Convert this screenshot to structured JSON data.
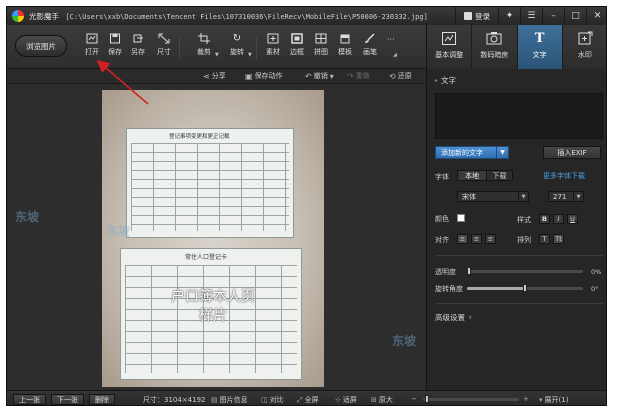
{
  "window": {
    "app_title": "光影魔手",
    "file_path": "[C:\\Users\\xxb\\Documents\\Tencent Files\\107310036\\FileRecv\\MobileFile\\P50606-230332.jpg]",
    "login_label": "登录"
  },
  "toolbar": {
    "browse_label": "浏览图片",
    "tools": [
      {
        "label": "打开",
        "icon": "open-icon"
      },
      {
        "label": "保存",
        "icon": "save-icon"
      },
      {
        "label": "另存",
        "icon": "save-as-icon"
      },
      {
        "label": "尺寸",
        "icon": "resize-icon"
      },
      {
        "label": "裁剪",
        "icon": "crop-icon"
      },
      {
        "label": "旋转",
        "icon": "rotate-icon"
      },
      {
        "label": "素材",
        "icon": "material-icon"
      },
      {
        "label": "边框",
        "icon": "border-icon"
      },
      {
        "label": "拼图",
        "icon": "collage-icon"
      },
      {
        "label": "模板",
        "icon": "template-icon"
      },
      {
        "label": "画笔",
        "icon": "brush-icon"
      }
    ],
    "more_label": "···"
  },
  "mode_tabs": [
    {
      "label": "基本调整",
      "icon": "adjust-icon",
      "active": false
    },
    {
      "label": "数码暗房",
      "icon": "camera-icon",
      "active": false
    },
    {
      "label": "文字",
      "icon": "text-T-icon",
      "active": true
    },
    {
      "label": "水印",
      "icon": "watermark-icon",
      "active": false
    }
  ],
  "actions": {
    "share": "分享",
    "save_action": "保存动作",
    "undo": "撤销",
    "redo": "重做",
    "restore": "还原"
  },
  "photo": {
    "card_top_title": "登记事项变更和更正记载",
    "card_bottom_title": "常住人口登记卡",
    "overlay_line1": "户口簿本人页",
    "overlay_line2": "样片",
    "watermark": "东坡"
  },
  "panel": {
    "section_text": "文字",
    "add_text_button": "添加新的文字",
    "insert_exif_button": "插入EXIF",
    "font_label": "字体",
    "font_local": "本地",
    "font_download": "下载",
    "more_fonts_link": "更多字体下载",
    "font_family": "宋体",
    "font_size": "271",
    "color_label": "颜色",
    "style_label": "样式",
    "style_bold": "B",
    "style_italic": "I",
    "style_underline": "U",
    "align_label": "对齐",
    "arrange_label": "排列",
    "opacity_label": "透明度",
    "opacity_value": "0%",
    "opacity_fraction": 0.0,
    "rotation_label": "旋转角度",
    "rotation_value": "0°",
    "rotation_fraction": 0.5,
    "advanced_label": "高级设置",
    "text_color": "#ffffff"
  },
  "status": {
    "prev": "上一张",
    "next": "下一张",
    "delete": "删除",
    "size": "尺寸：3104×4192",
    "image_info": "图片信息",
    "compare": "对比",
    "fullscreen": "全屏",
    "fit": "适屏",
    "original": "原大",
    "expand": "展开(1)"
  },
  "colors": {
    "accent_blue": "#2f6fb3",
    "annotation_red": "#d32020",
    "link_blue": "#4aa2e8"
  }
}
